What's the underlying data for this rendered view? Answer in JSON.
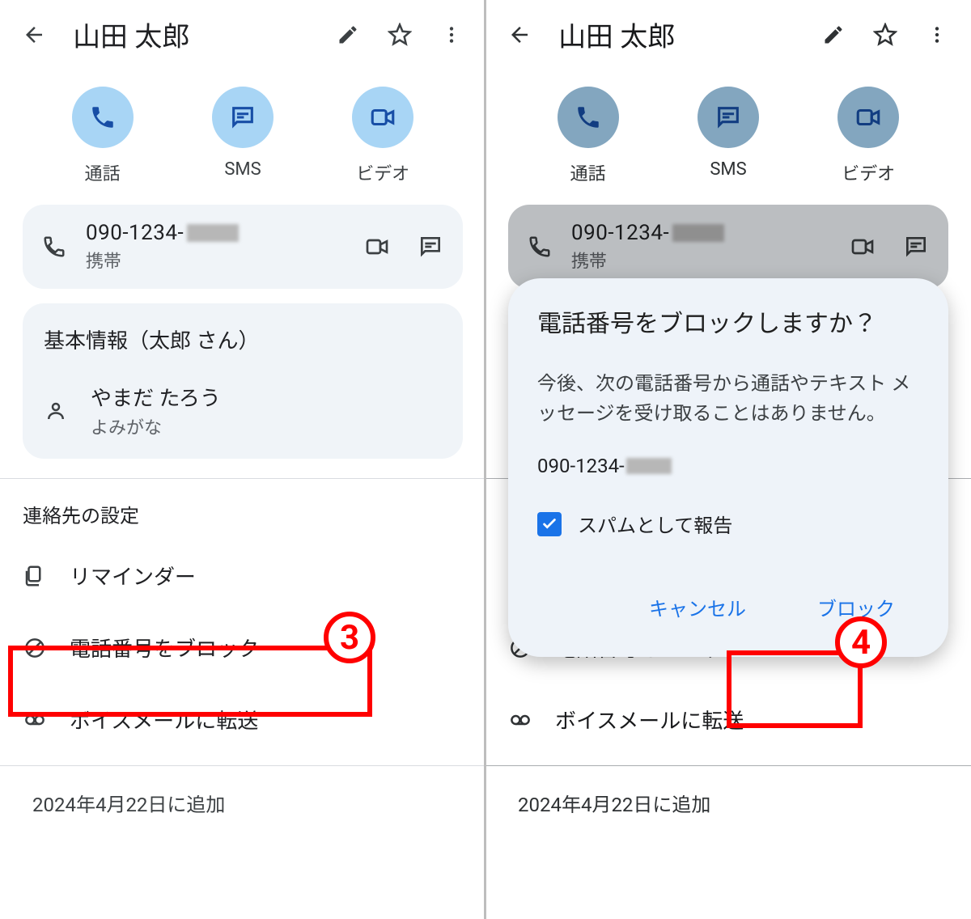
{
  "header": {
    "contact_name": "山田 太郎"
  },
  "actions": {
    "call": "通話",
    "sms": "SMS",
    "video": "ビデオ"
  },
  "phone": {
    "number_visible": "090-1234-",
    "type": "携帯"
  },
  "info": {
    "title": "基本情報（太郎 さん）",
    "yomi_value": "やまだ たろう",
    "yomi_caption": "よみがな"
  },
  "settings_title": "連絡先の設定",
  "list": {
    "reminder": "リマインダー",
    "block": "電話番号をブロック",
    "voicemail": "ボイスメールに転送"
  },
  "added": "2024年4月22日に追加",
  "dialog": {
    "title": "電話番号をブロックしますか？",
    "body": "今後、次の電話番号から通話やテキスト メッセージを受け取ることはありません。",
    "number_visible": "090-1234-",
    "spam_label": "スパムとして報告",
    "cancel": "キャンセル",
    "confirm": "ブロック"
  },
  "badge3": "3",
  "badge4": "4"
}
